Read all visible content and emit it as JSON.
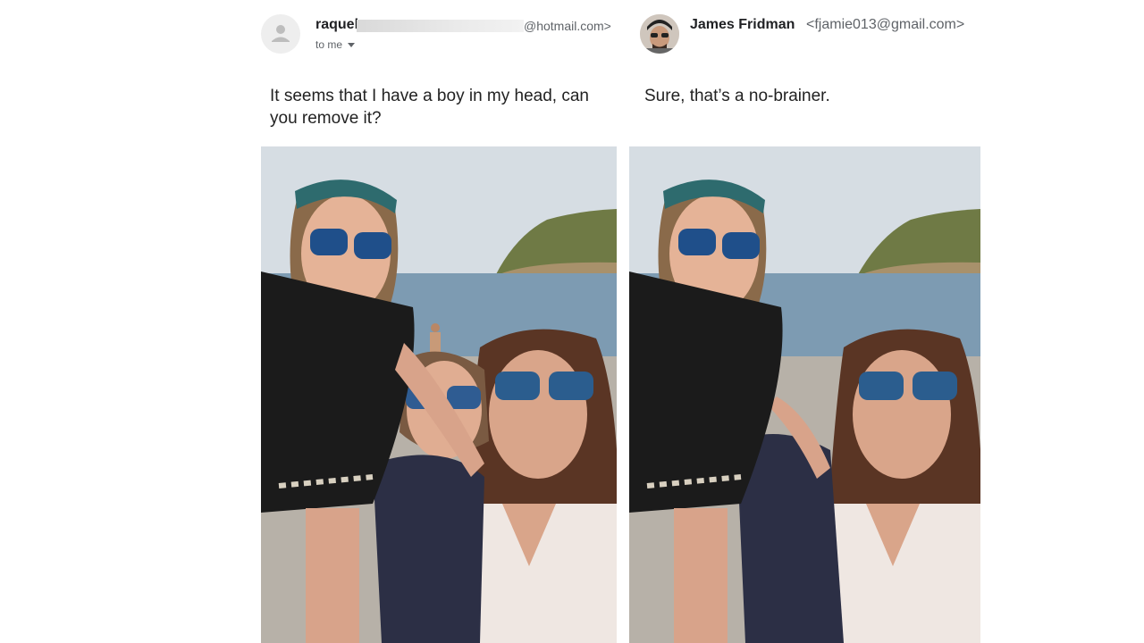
{
  "left_email": {
    "sender_name": "raquel",
    "sender_email_suffix": "@hotmail.com>",
    "recipient_label": "to me",
    "avatar_icon": "person-icon",
    "body": "It seems that I have a boy in my head, can you remove it?"
  },
  "right_email": {
    "sender_name": "James Fridman",
    "sender_email": "<fjamie013@gmail.com>",
    "body": "Sure, that’s a no-brainer."
  },
  "colors": {
    "text": "#202124",
    "secondary_text": "#5f6368",
    "avatar_bg": "#eeeeee"
  }
}
